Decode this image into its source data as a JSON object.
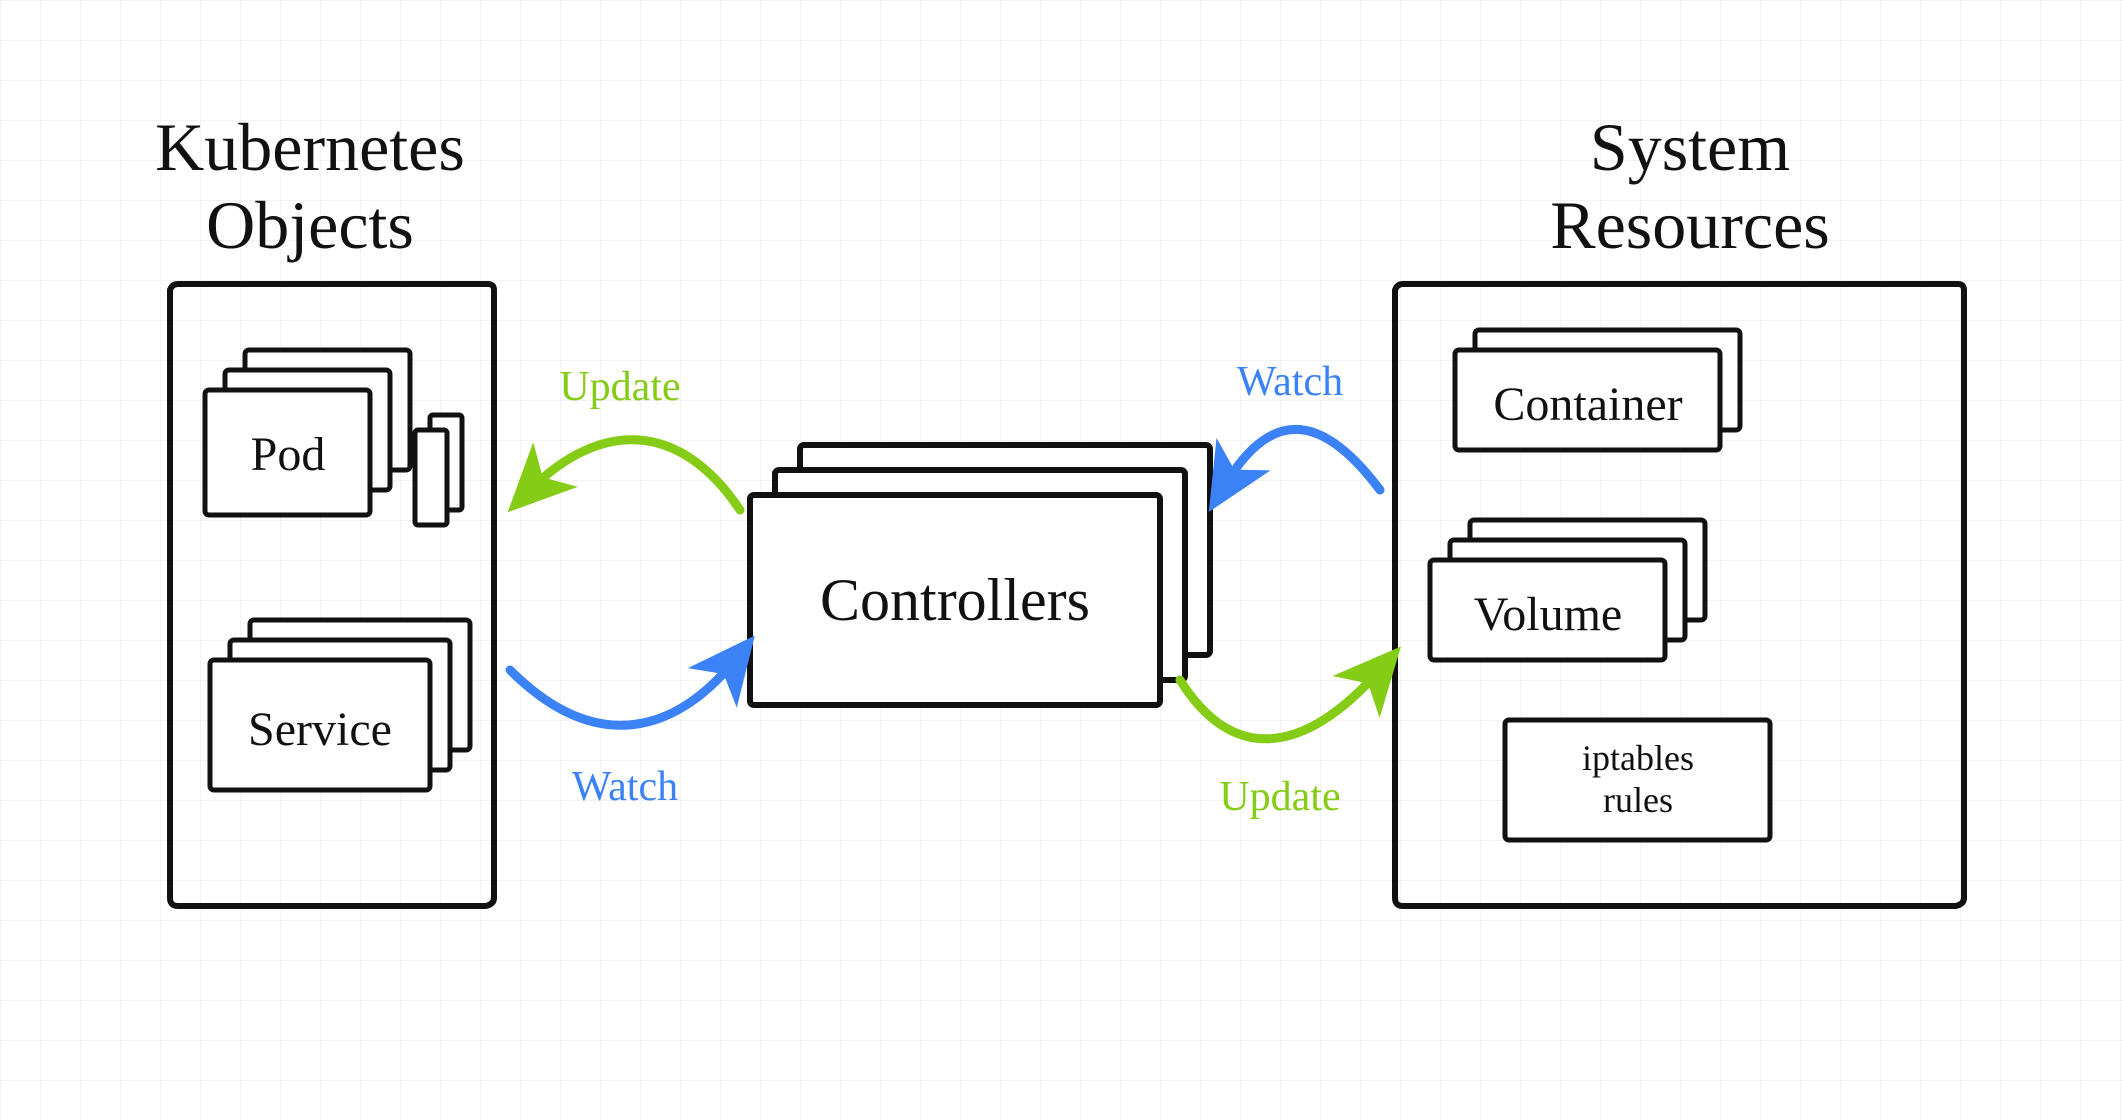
{
  "diagram": {
    "left": {
      "title_l1": "Kubernetes",
      "title_l2": "Objects",
      "pod": "Pod",
      "service": "Service"
    },
    "center": {
      "controllers": "Controllers"
    },
    "right": {
      "title_l1": "System",
      "title_l2": "Resources",
      "container": "Container",
      "volume": "Volume",
      "iptables_l1": "iptables",
      "iptables_l2": "rules"
    },
    "arrows": {
      "update_left": "Update",
      "watch_left": "Watch",
      "watch_right": "Watch",
      "update_right": "Update"
    },
    "colors": {
      "watch": "#3b82f6",
      "update": "#84cc16",
      "ink": "#111111"
    }
  }
}
